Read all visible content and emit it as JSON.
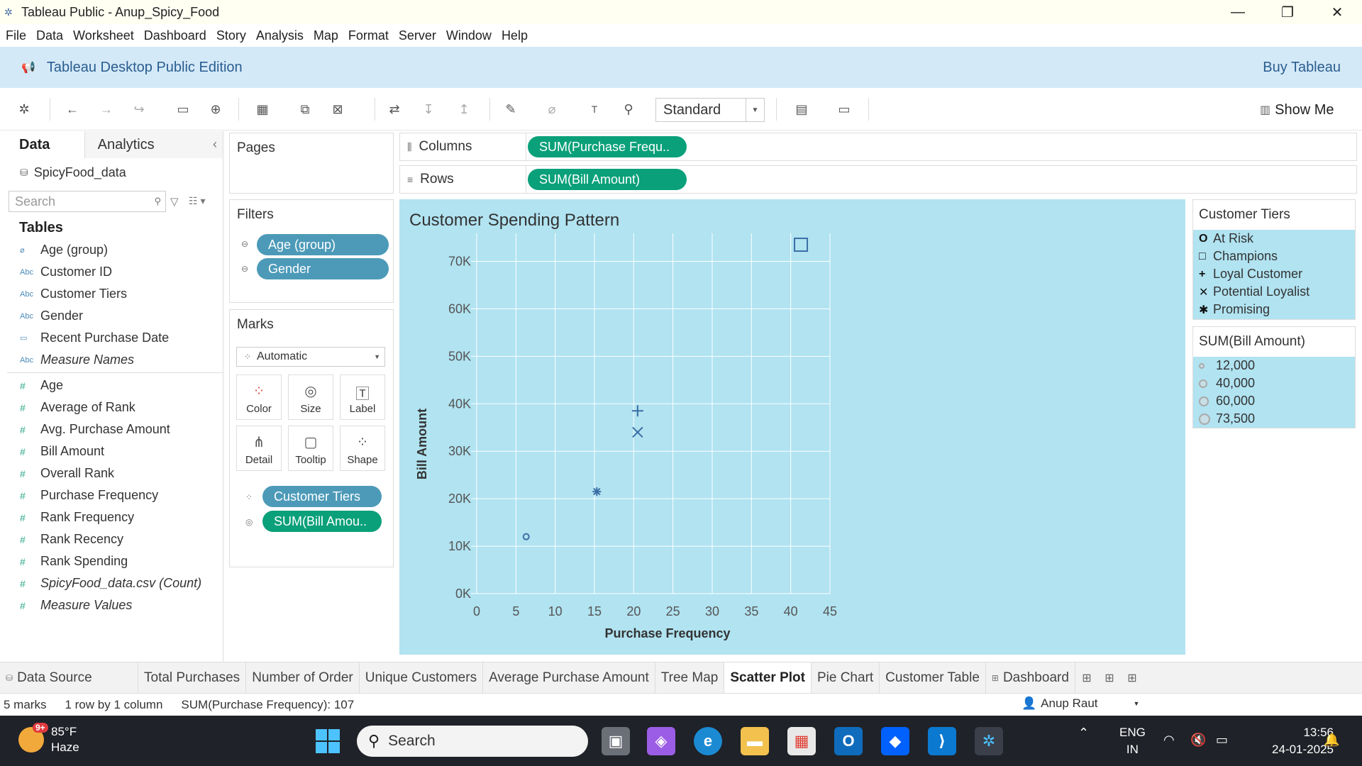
{
  "window": {
    "title": "Tableau Public - Anup_Spicy_Food",
    "controls": [
      "—",
      "❐",
      "✕"
    ]
  },
  "menu": [
    "File",
    "Data",
    "Worksheet",
    "Dashboard",
    "Story",
    "Analysis",
    "Map",
    "Format",
    "Server",
    "Window",
    "Help"
  ],
  "banner": {
    "edition": "Tableau Desktop Public Edition",
    "buy": "Buy Tableau"
  },
  "toolbar": {
    "fit_mode": "Standard",
    "show_me": "Show Me"
  },
  "data_pane": {
    "tab_data": "Data",
    "tab_analytics": "Analytics",
    "datasource": "SpicyFood_data",
    "search_placeholder": "Search",
    "tables_heading": "Tables",
    "dimensions": [
      {
        "name": "Age (group)",
        "type": "group",
        "italic": false
      },
      {
        "name": "Customer ID",
        "type": "Abc",
        "italic": false
      },
      {
        "name": "Customer Tiers",
        "type": "Abc",
        "italic": false
      },
      {
        "name": "Gender",
        "type": "Abc",
        "italic": false
      },
      {
        "name": "Recent Purchase Date",
        "type": "date",
        "italic": false
      },
      {
        "name": "Measure Names",
        "type": "Abc",
        "italic": true
      }
    ],
    "measures": [
      {
        "name": "Age",
        "italic": false
      },
      {
        "name": "Average of Rank",
        "italic": false
      },
      {
        "name": "Avg. Purchase Amount",
        "italic": false
      },
      {
        "name": "Bill Amount",
        "italic": false
      },
      {
        "name": "Overall Rank",
        "italic": false
      },
      {
        "name": "Purchase Frequency",
        "italic": false
      },
      {
        "name": "Rank Frequency",
        "italic": false
      },
      {
        "name": "Rank Recency",
        "italic": false
      },
      {
        "name": "Rank Spending",
        "italic": false
      },
      {
        "name": "SpicyFood_data.csv (Count)",
        "italic": true
      },
      {
        "name": "Measure Values",
        "italic": true
      }
    ]
  },
  "pages": {
    "title": "Pages"
  },
  "filters": {
    "title": "Filters",
    "items": [
      "Age (group)",
      "Gender"
    ]
  },
  "marks": {
    "title": "Marks",
    "type": "Automatic",
    "buttons": [
      "Color",
      "Size",
      "Label",
      "Detail",
      "Tooltip",
      "Shape"
    ],
    "pills": [
      "Customer Tiers",
      "SUM(Bill Amou.."
    ]
  },
  "shelves": {
    "columns_label": "Columns",
    "columns_pill": "SUM(Purchase Frequ..",
    "rows_label": "Rows",
    "rows_pill": "SUM(Bill Amount)"
  },
  "chart_data": {
    "type": "scatter",
    "title": "Customer Spending Pattern",
    "xlabel": "Purchase Frequency",
    "ylabel": "Bill Amount",
    "xlim": [
      0,
      45
    ],
    "ylim": [
      0,
      75000
    ],
    "xticks": [
      "0",
      "5",
      "10",
      "15",
      "20",
      "25",
      "30",
      "35",
      "40",
      "45"
    ],
    "yticks": [
      "0K",
      "10K",
      "20K",
      "30K",
      "40K",
      "50K",
      "60K",
      "70K"
    ],
    "grid": true,
    "points": [
      {
        "tier": "At Risk",
        "shape": "circle",
        "x": 6.3,
        "y": 12000
      },
      {
        "tier": "Promising",
        "shape": "asterisk",
        "x": 15.3,
        "y": 21500
      },
      {
        "tier": "Potential Loyalist",
        "shape": "x",
        "x": 20.5,
        "y": 34000
      },
      {
        "tier": "Loyal Customer",
        "shape": "plus",
        "x": 20.5,
        "y": 38500
      },
      {
        "tier": "Champions",
        "shape": "square",
        "x": 41.3,
        "y": 73500
      }
    ]
  },
  "legend_tiers": {
    "title": "Customer Tiers",
    "items": [
      {
        "symbol": "O",
        "label": "At Risk"
      },
      {
        "symbol": "□",
        "label": "Champions"
      },
      {
        "symbol": "+",
        "label": "Loyal Customer"
      },
      {
        "symbol": "✕",
        "label": "Potential Loyalist"
      },
      {
        "symbol": "✱",
        "label": "Promising"
      }
    ]
  },
  "legend_size": {
    "title": "SUM(Bill Amount)",
    "items": [
      "12,000",
      "40,000",
      "60,000",
      "73,500"
    ]
  },
  "sheet_tabs": {
    "items": [
      "Data Source",
      "Total Purchases",
      "Number of Order",
      "Unique Customers",
      "Average Purchase Amount",
      "Tree Map",
      "Scatter Plot",
      "Pie Chart",
      "Customer Table",
      "Dashboard"
    ],
    "active": "Scatter Plot"
  },
  "status": {
    "marks": "5 marks",
    "dims": "1 row by 1 column",
    "sum": "SUM(Purchase Frequency): 107",
    "user": "Anup Raut"
  },
  "taskbar": {
    "temperature": "85°F",
    "weather": "Haze",
    "notifications": "9+",
    "search": "Search",
    "lang1": "ENG",
    "lang2": "IN",
    "time": "13:56",
    "date": "24-01-2025"
  }
}
